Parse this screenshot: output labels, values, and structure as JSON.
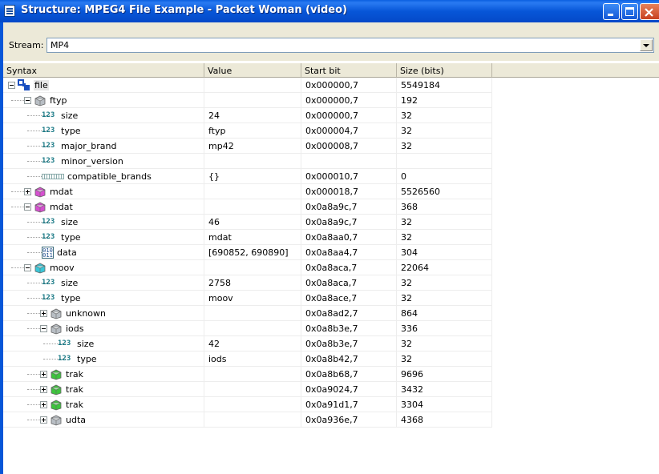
{
  "window": {
    "title": "Structure: MPEG4 File Example - Packet Woman (video)"
  },
  "stream": {
    "label": "Stream:",
    "value": "MP4"
  },
  "columns": [
    "Syntax",
    "Value",
    "Start bit",
    "Size (bits)"
  ],
  "rows": [
    {
      "depth": 0,
      "expander": "minus",
      "icon": "file-icon",
      "name": "file",
      "value": "",
      "start": "0x000000,7",
      "size": "5549184"
    },
    {
      "depth": 1,
      "expander": "minus",
      "icon": "box-gray-icon",
      "name": "ftyp",
      "value": "",
      "start": "0x000000,7",
      "size": "192"
    },
    {
      "depth": 2,
      "expander": "",
      "icon": "number-icon",
      "name": "size",
      "value": "24",
      "start": "0x000000,7",
      "size": "32"
    },
    {
      "depth": 2,
      "expander": "",
      "icon": "number-icon",
      "name": "type",
      "value": "ftyp",
      "start": "0x000004,7",
      "size": "32"
    },
    {
      "depth": 2,
      "expander": "",
      "icon": "number-icon",
      "name": "major_brand",
      "value": "mp42",
      "start": "0x000008,7",
      "size": "32"
    },
    {
      "depth": 2,
      "expander": "",
      "icon": "number-icon",
      "name": "minor_version",
      "value": "",
      "start": "",
      "size": ""
    },
    {
      "depth": 2,
      "expander": "",
      "icon": "array-icon",
      "name": "compatible_brands",
      "value": "{}",
      "start": "0x000010,7",
      "size": "0"
    },
    {
      "depth": 1,
      "expander": "plus",
      "icon": "box-pink-icon",
      "name": "mdat",
      "value": "",
      "start": "0x000018,7",
      "size": "5526560"
    },
    {
      "depth": 1,
      "expander": "minus",
      "icon": "box-pink-icon",
      "name": "mdat",
      "value": "",
      "start": "0x0a8a9c,7",
      "size": "368"
    },
    {
      "depth": 2,
      "expander": "",
      "icon": "number-icon",
      "name": "size",
      "value": "46",
      "start": "0x0a8a9c,7",
      "size": "32"
    },
    {
      "depth": 2,
      "expander": "",
      "icon": "number-icon",
      "name": "type",
      "value": "mdat",
      "start": "0x0a8aa0,7",
      "size": "32"
    },
    {
      "depth": 2,
      "expander": "",
      "icon": "data-icon",
      "name": "data",
      "value": "[690852, 690890]",
      "start": "0x0a8aa4,7",
      "size": "304"
    },
    {
      "depth": 1,
      "expander": "minus",
      "icon": "box-cyan-icon",
      "name": "moov",
      "value": "",
      "start": "0x0a8aca,7",
      "size": "22064"
    },
    {
      "depth": 2,
      "expander": "",
      "icon": "number-icon",
      "name": "size",
      "value": "2758",
      "start": "0x0a8aca,7",
      "size": "32"
    },
    {
      "depth": 2,
      "expander": "",
      "icon": "number-icon",
      "name": "type",
      "value": "moov",
      "start": "0x0a8ace,7",
      "size": "32"
    },
    {
      "depth": 2,
      "expander": "plus",
      "icon": "box-gray-icon",
      "name": "unknown",
      "value": "",
      "start": "0x0a8ad2,7",
      "size": "864"
    },
    {
      "depth": 2,
      "expander": "minus",
      "icon": "box-gray-icon",
      "name": "iods",
      "value": "",
      "start": "0x0a8b3e,7",
      "size": "336"
    },
    {
      "depth": 3,
      "expander": "",
      "icon": "number-icon",
      "name": "size",
      "value": "42",
      "start": "0x0a8b3e,7",
      "size": "32"
    },
    {
      "depth": 3,
      "expander": "",
      "icon": "number-icon",
      "name": "type",
      "value": "iods",
      "start": "0x0a8b42,7",
      "size": "32"
    },
    {
      "depth": 2,
      "expander": "plus",
      "icon": "box-green-icon",
      "name": "trak",
      "value": "",
      "start": "0x0a8b68,7",
      "size": "9696"
    },
    {
      "depth": 2,
      "expander": "plus",
      "icon": "box-green-icon",
      "name": "trak",
      "value": "",
      "start": "0x0a9024,7",
      "size": "3432"
    },
    {
      "depth": 2,
      "expander": "plus",
      "icon": "box-green-icon",
      "name": "trak",
      "value": "",
      "start": "0x0a91d1,7",
      "size": "3304"
    },
    {
      "depth": 2,
      "expander": "plus",
      "icon": "box-gray-icon",
      "name": "udta",
      "value": "",
      "start": "0x0a936e,7",
      "size": "4368"
    }
  ],
  "colors": {
    "titlebar": "#0756d8",
    "box-gray-icon": "#b8bec4",
    "box-pink-icon": "#d64fd0",
    "box-cyan-icon": "#38c7d8",
    "box-green-icon": "#3dc43d",
    "number-icon": "#1a7a86",
    "file-icon": "#1a4fc0"
  },
  "icon_glyphs": {
    "number-icon": "123",
    "data-icon": "010 011"
  }
}
